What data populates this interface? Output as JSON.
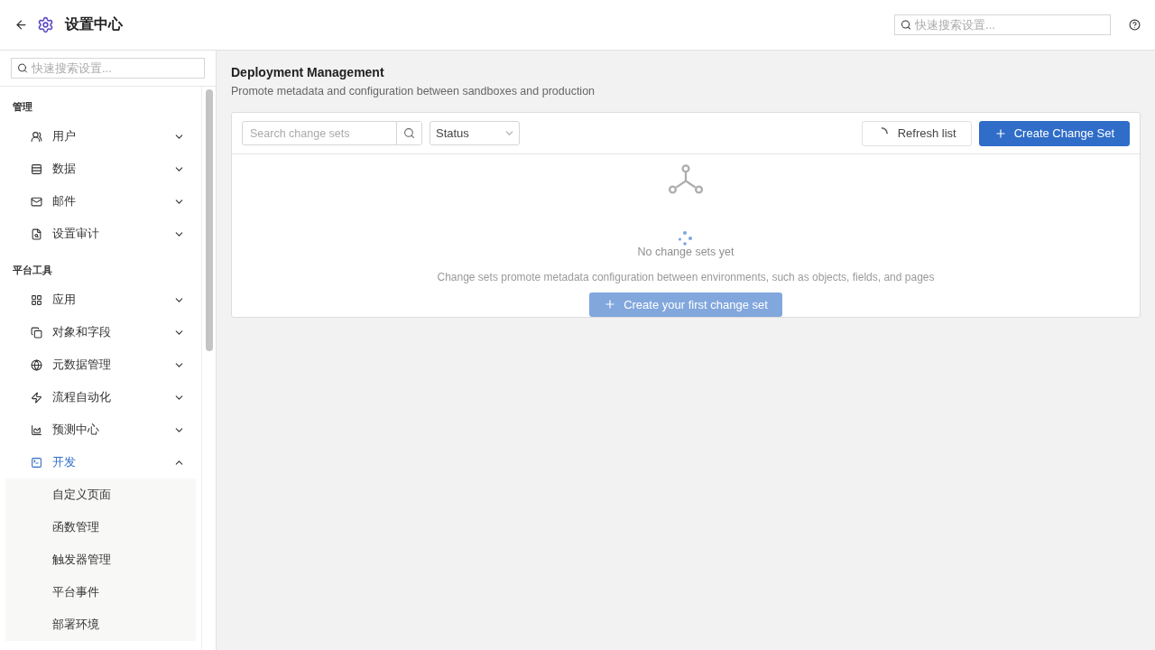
{
  "header": {
    "title": "设置中心",
    "search": {
      "placeholder": "快速搜索设置..."
    }
  },
  "sidebar": {
    "search": {
      "placeholder": "快速搜索设置..."
    },
    "sections": [
      {
        "title": "管理",
        "items": [
          {
            "label": "用户",
            "expanded": false
          },
          {
            "label": "数据",
            "expanded": false
          },
          {
            "label": "邮件",
            "expanded": false
          },
          {
            "label": "设置审计",
            "expanded": false
          }
        ]
      },
      {
        "title": "平台工具",
        "items": [
          {
            "label": "应用",
            "expanded": false
          },
          {
            "label": "对象和字段",
            "expanded": false
          },
          {
            "label": "元数据管理",
            "expanded": false
          },
          {
            "label": "流程自动化",
            "expanded": false
          },
          {
            "label": "预测中心",
            "expanded": false
          },
          {
            "label": "开发",
            "expanded": true,
            "children": [
              {
                "label": "自定义页面"
              },
              {
                "label": "函数管理"
              },
              {
                "label": "触发器管理"
              },
              {
                "label": "平台事件"
              },
              {
                "label": "部署环境"
              }
            ]
          }
        ]
      }
    ]
  },
  "page": {
    "title": "Deployment Management",
    "subtitle": "Promote metadata and configuration between sandboxes and production",
    "search": {
      "placeholder": "Search change sets"
    },
    "status_filter": {
      "value": "Status"
    },
    "refresh_button": {
      "label": "Refresh list"
    },
    "create_button": {
      "label": "Create Change Set"
    },
    "loading": true,
    "empty_state": {
      "title": "No change sets yet",
      "description": "Change sets promote metadata configuration between environments, such as objects, fields, and pages",
      "button": "Create your first change set"
    }
  }
}
